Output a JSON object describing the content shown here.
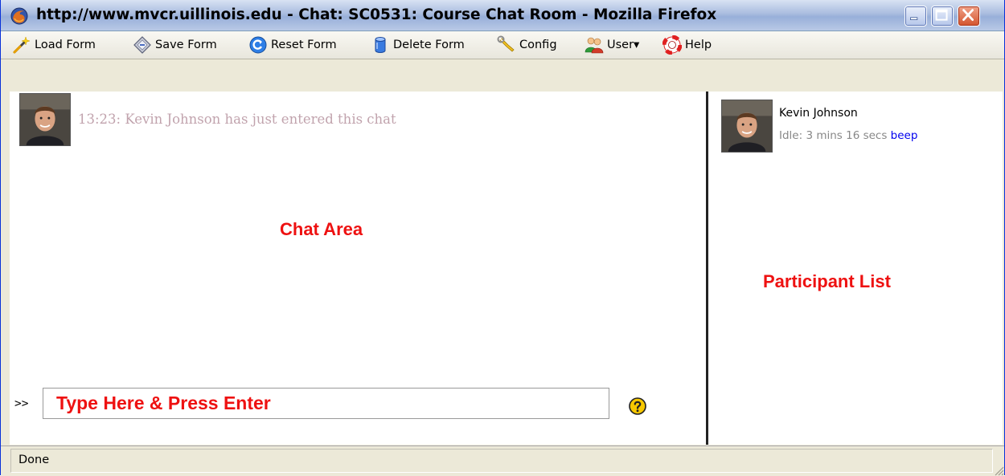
{
  "window": {
    "title": "http://www.mvcr.uillinois.edu - Chat: SC0531: Course Chat Room - Mozilla Firefox",
    "icon": "firefox-icon",
    "controls": [
      "minimize-icon",
      "maximize-icon",
      "close-icon"
    ]
  },
  "toolbar": {
    "items": [
      {
        "label": "Load Form",
        "icon": "magic-wand-icon"
      },
      {
        "label": "Save Form",
        "icon": "save-diamond-icon"
      },
      {
        "label": "Reset Form",
        "icon": "reset-icon"
      },
      {
        "label": "Delete Form",
        "icon": "database-icon"
      },
      {
        "label": "Config",
        "icon": "wrench-icon"
      },
      {
        "label": "User▾",
        "icon": "users-icon"
      },
      {
        "label": "Help",
        "icon": "lifebuoy-icon"
      }
    ]
  },
  "chat": {
    "messages": [
      {
        "text": "13:23: Kevin Johnson has just entered this chat",
        "icon": "avatar"
      }
    ],
    "annotation": "Chat Area",
    "prompt": ">>",
    "input_placeholder": "Type Here & Press Enter",
    "input_value": "",
    "help_icon": "help-question-icon"
  },
  "participants": {
    "annotation": "Participant List",
    "list": [
      {
        "name": "Kevin Johnson",
        "idle": "Idle: 3 mins 16 secs",
        "action": "beep"
      }
    ]
  },
  "status": {
    "text": "Done"
  },
  "colors": {
    "annotation": "#ee1111",
    "message_text": "#c1a3ad",
    "link": "#0000ee"
  }
}
